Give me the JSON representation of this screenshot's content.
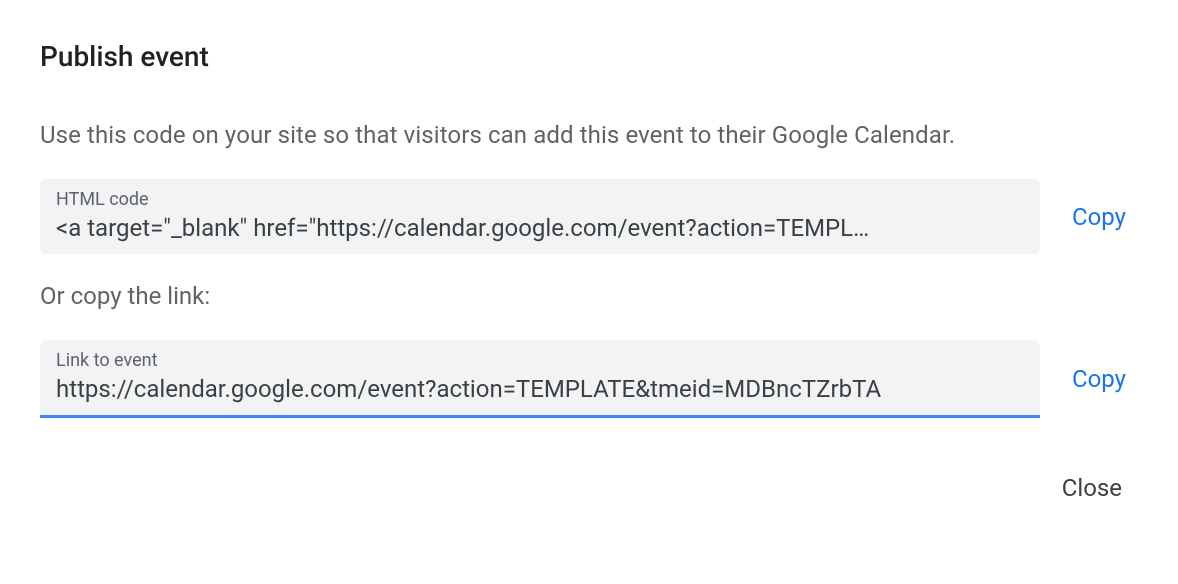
{
  "dialog": {
    "title": "Publish event",
    "description": "Use this code on your site so that visitors can add this event to their Google Calendar.",
    "sub_description": "Or copy the link:",
    "close_label": "Close"
  },
  "html_code": {
    "label": "HTML code",
    "value": "<a target=\"_blank\" href=\"https://calendar.google.com/event?action=TEMPL…",
    "copy_label": "Copy"
  },
  "link": {
    "label": "Link to event",
    "value": "https://calendar.google.com/event?action=TEMPLATE&tmeid=MDBncTZrbTA",
    "copy_label": "Copy"
  }
}
